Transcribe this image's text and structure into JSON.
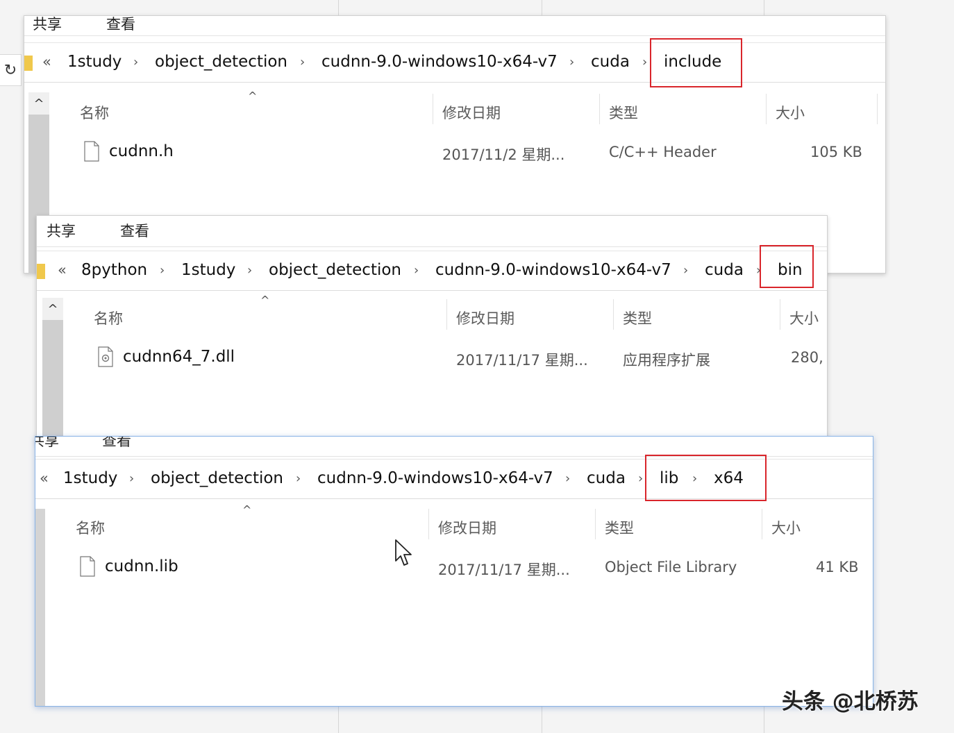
{
  "ribbon": {
    "share": "共享",
    "view": "查看"
  },
  "columns": {
    "name": "名称",
    "modified": "修改日期",
    "type": "类型",
    "size": "大小"
  },
  "window1": {
    "breadcrumb": [
      "1study",
      "object_detection",
      "cudnn-9.0-windows10-x64-v7",
      "cuda",
      "include"
    ],
    "file": {
      "name": "cudnn.h",
      "modified": "2017/11/2 星期...",
      "type": "C/C++ Header",
      "size": "105 KB"
    }
  },
  "window2": {
    "breadcrumb": [
      "8python",
      "1study",
      "object_detection",
      "cudnn-9.0-windows10-x64-v7",
      "cuda",
      "bin"
    ],
    "file": {
      "name": "cudnn64_7.dll",
      "modified": "2017/11/17 星期...",
      "type": "应用程序扩展",
      "size": "280,"
    }
  },
  "window3": {
    "breadcrumb": [
      "1study",
      "object_detection",
      "cudnn-9.0-windows10-x64-v7",
      "cuda",
      "lib",
      "x64"
    ],
    "file": {
      "name": "cudnn.lib",
      "modified": "2017/11/17 星期...",
      "type": "Object File Library",
      "size": "41 KB"
    }
  },
  "nav": {
    "overflow_glyph": "«",
    "separator_glyph": "›",
    "scroll_up_glyph": "^",
    "refresh_glyph": "↻"
  },
  "watermark": "头条 @北桥苏",
  "colors": {
    "highlight": "#d9252b",
    "folder": "#f0c84c",
    "active_border": "#8ab4e6"
  }
}
